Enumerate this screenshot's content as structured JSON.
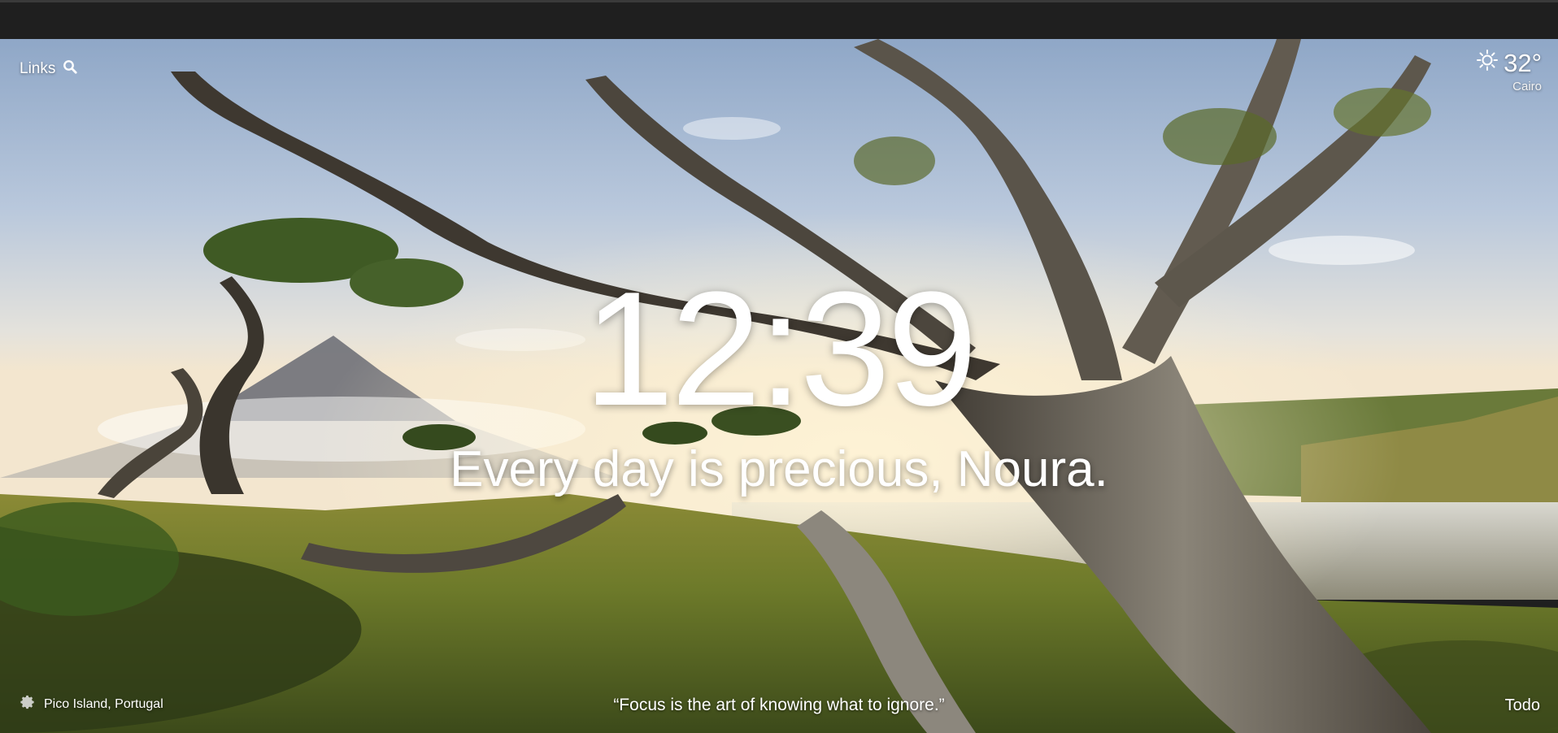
{
  "top_left": {
    "links_label": "Links",
    "search_icon": "search-icon"
  },
  "weather": {
    "icon": "sun-icon",
    "temperature": "32°",
    "city": "Cairo"
  },
  "clock": {
    "time": "12:39"
  },
  "greeting": {
    "text": "Every day is precious, Noura."
  },
  "footer": {
    "settings_icon": "gear-icon",
    "photo_location": "Pico Island, Portugal",
    "quote": "“Focus is the art of knowing what to ignore.”",
    "todo_label": "Todo"
  },
  "colors": {
    "topbar": "#1f1f1f",
    "text": "#ffffff"
  }
}
